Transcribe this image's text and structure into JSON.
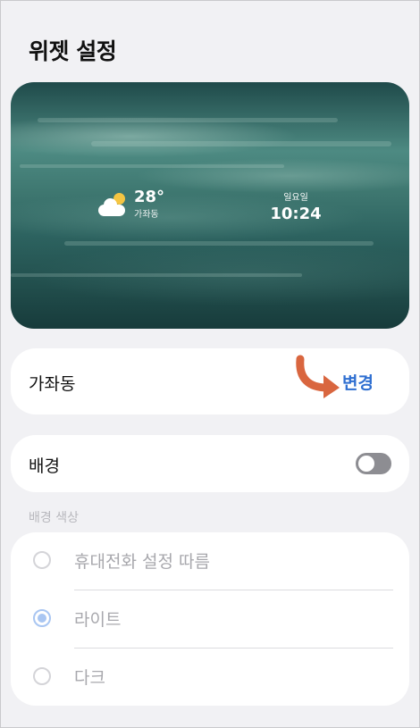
{
  "header": {
    "title": "위젯 설정"
  },
  "preview": {
    "weather": {
      "icon": "partly-cloudy-icon",
      "temperature": "28°",
      "location": "가좌동"
    },
    "clock": {
      "day": "일요일",
      "time": "10:24"
    }
  },
  "location": {
    "name": "가좌동",
    "change_label": "변경",
    "arrow_color": "#d9663f"
  },
  "background": {
    "label": "배경",
    "toggle_on": false
  },
  "background_color": {
    "section_label": "배경 색상",
    "options": [
      {
        "label": "휴대전화 설정 따름",
        "selected": false
      },
      {
        "label": "라이트",
        "selected": true
      },
      {
        "label": "다크",
        "selected": false
      }
    ]
  }
}
